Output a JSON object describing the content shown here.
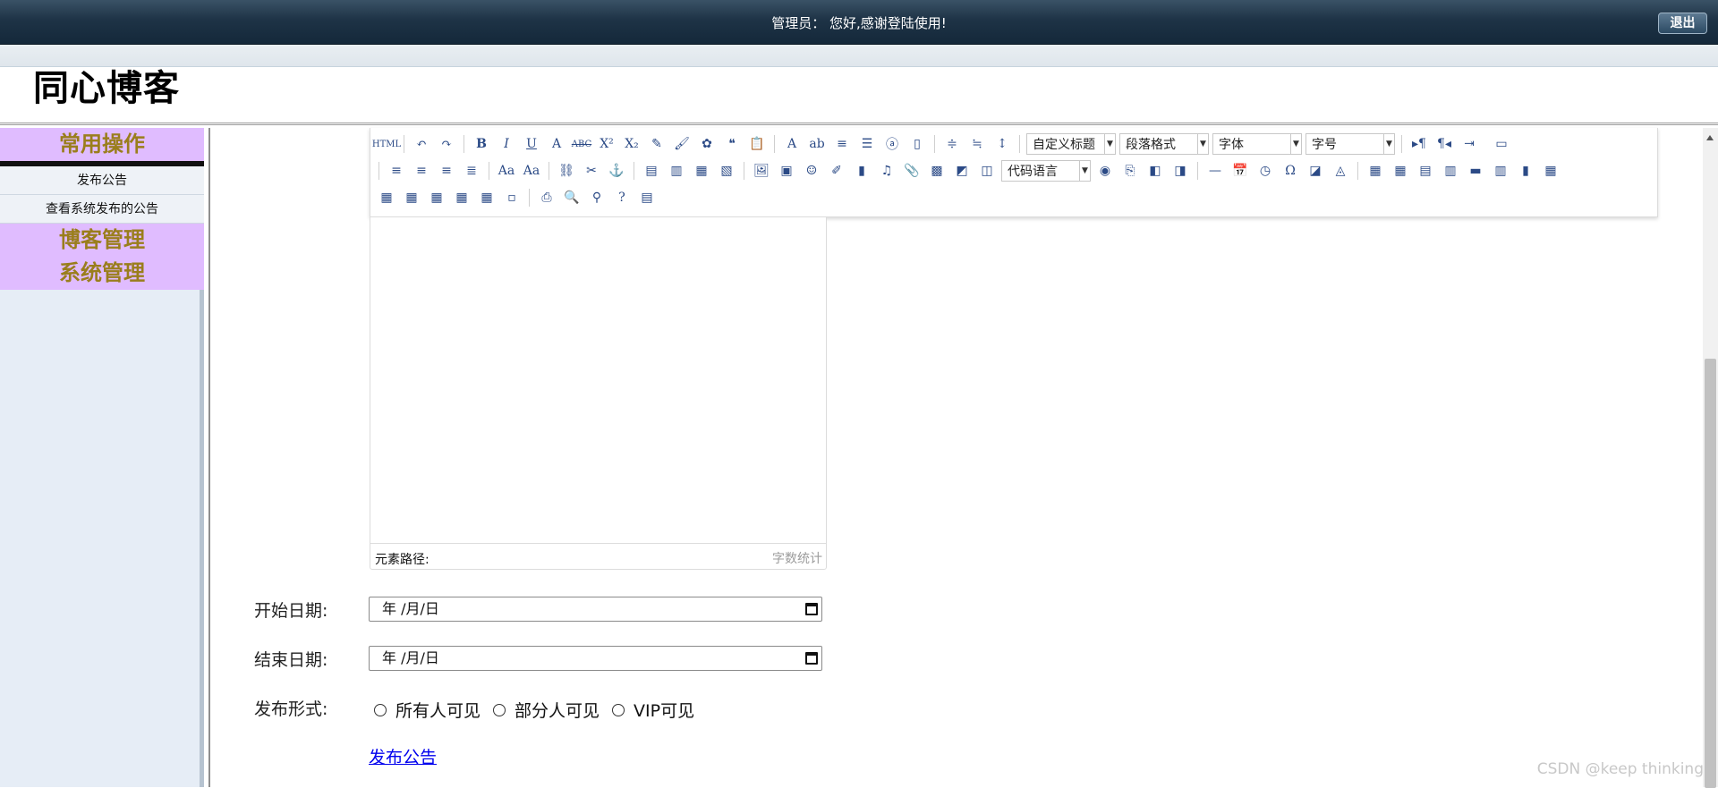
{
  "topbar": {
    "message": "管理员：  您好,感谢登陆使用!",
    "logout_label": "退出"
  },
  "header": {
    "site_title": "同心博客"
  },
  "sidebar": {
    "groups": [
      {
        "label": "常用操作",
        "items": [
          "发布公告",
          "查看系统发布的公告"
        ]
      },
      {
        "label": "博客管理"
      },
      {
        "label": "系统管理"
      }
    ]
  },
  "editor": {
    "toolbar": {
      "custom_heading": "自定义标题",
      "paragraph": "段落格式",
      "font": "字体",
      "font_size": "字号",
      "code_language": "代码语言"
    },
    "status_left": "元素路径:",
    "status_right": "字数统计"
  },
  "form": {
    "start_date_label": "开始日期:",
    "start_date_value": "年 /月/日",
    "end_date_label": "结束日期:",
    "end_date_value": "年 /月/日",
    "publish_mode_label": "发布形式:",
    "publish_modes": [
      "所有人可见",
      "部分人可见",
      "VIP可见"
    ],
    "submit_label": "发布公告"
  },
  "watermark": "CSDN @keep   thinking"
}
